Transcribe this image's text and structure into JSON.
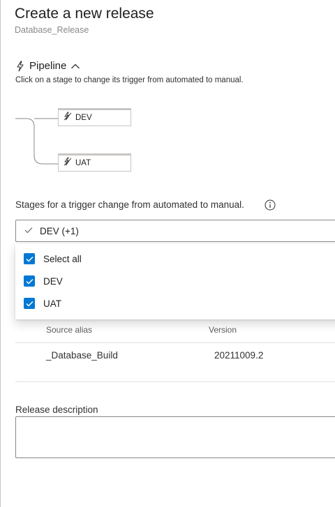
{
  "header": {
    "title": "Create a new release",
    "subtitle": "Database_Release"
  },
  "pipeline": {
    "label": "Pipeline",
    "hint": "Click on a stage to change its trigger from automated to manual.",
    "stages": [
      {
        "label": "DEV"
      },
      {
        "label": "UAT"
      }
    ]
  },
  "trigger": {
    "label": "Stages for a trigger change from automated to manual.",
    "selected_value": "DEV (+1)",
    "options": [
      {
        "label": "Select all",
        "checked": true
      },
      {
        "label": "DEV",
        "checked": true
      },
      {
        "label": "UAT",
        "checked": true
      }
    ]
  },
  "artifacts": {
    "columns": [
      "Source alias",
      "Version"
    ],
    "rows": [
      {
        "source_alias": "_Database_Build",
        "version": "20211009.2"
      }
    ]
  },
  "description": {
    "label": "Release description",
    "value": ""
  },
  "colors": {
    "accent": "#0078d4",
    "text": "#323130",
    "border": "#8a8886",
    "muted": "#8a8886"
  },
  "icons": {
    "pipeline": "lightning-bolt-icon",
    "collapse": "chevron-up-icon",
    "stage": "manual-trigger-icon",
    "info": "info-icon",
    "selected": "checkmark-icon",
    "checkbox": "checkbox-checked-icon"
  }
}
